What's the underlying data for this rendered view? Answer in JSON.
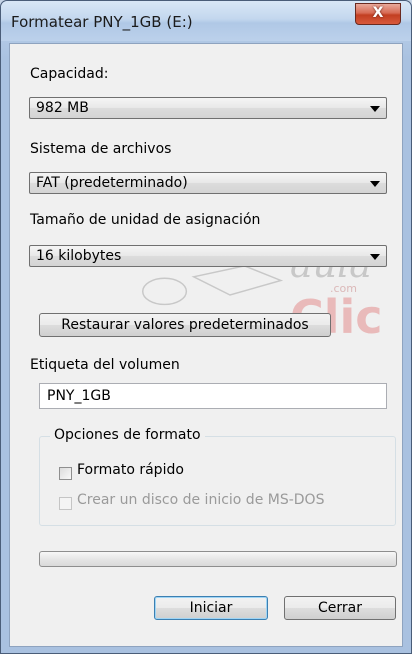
{
  "window": {
    "title": "Formatear PNY_1GB (E:)",
    "close_glyph": "X"
  },
  "capacity": {
    "label": "Capacidad:",
    "value": "982 MB"
  },
  "file_system": {
    "label": "Sistema de archivos",
    "value": "FAT (predeterminado)"
  },
  "allocation": {
    "label": "Tamaño de unidad de asignación",
    "value": "16 kilobytes"
  },
  "restore_button": "Restaurar valores predeterminados",
  "volume": {
    "label": "Etiqueta del volumen",
    "value": "PNY_1GB"
  },
  "format_options": {
    "title": "Opciones de formato",
    "quick_format": {
      "label": "Formato rápido",
      "checked": false
    },
    "msdos_disk": {
      "label": "Crear un disco de inicio de MS-DOS",
      "checked": false,
      "enabled": false
    }
  },
  "progress": {
    "fraction": 0
  },
  "buttons": {
    "start": "Iniciar",
    "close": "Cerrar"
  },
  "watermark": {
    "word1": "aula",
    "word2": "Clic",
    "suffix": ".com"
  },
  "colors": {
    "titlebar": "#c3d7ee",
    "close_button": "#c23f22",
    "dialog_bg": "#f0f0f0"
  }
}
